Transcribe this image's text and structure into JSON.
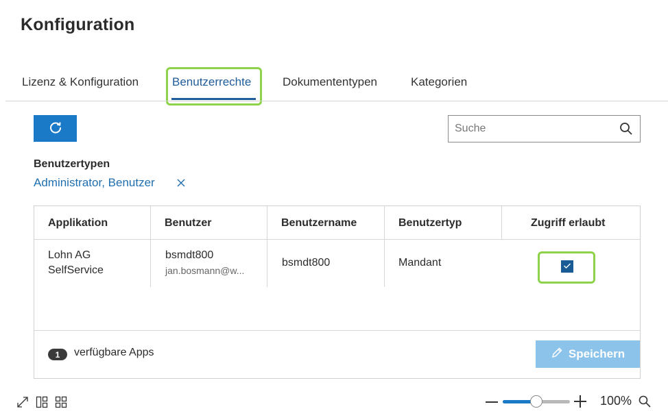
{
  "page": {
    "title": "Konfiguration"
  },
  "tabs": [
    {
      "label": "Lizenz & Konfiguration",
      "active": false
    },
    {
      "label": "Benutzerrechte",
      "active": true
    },
    {
      "label": "Dokumententypen",
      "active": false
    },
    {
      "label": "Kategorien",
      "active": false
    }
  ],
  "toolbar": {
    "refresh_icon": "refresh-icon"
  },
  "search": {
    "placeholder": "Suche",
    "value": ""
  },
  "filter": {
    "label": "Benutzertypen",
    "value": "Administrator, Benutzer"
  },
  "table": {
    "columns": [
      "Applikation",
      "Benutzer",
      "Benutzername",
      "Benutzertyp",
      "Zugriff erlaubt"
    ],
    "rows": [
      {
        "applikation_line1": "Lohn AG",
        "applikation_line2": "SelfService",
        "benutzer": "bsmdt800",
        "benutzer_email": "jan.bosmann@w...",
        "benutzername": "bsmdt800",
        "benutzertyp": "Mandant",
        "zugriff": true
      }
    ]
  },
  "footer": {
    "count": "1",
    "count_label": "verfügbare Apps",
    "save_label": "Speichern"
  },
  "zoom": {
    "level": 0.5,
    "label": "100%"
  },
  "colors": {
    "accent": "#1a7ac8",
    "tab_active": "#1f5c9b",
    "highlight": "#8ed24a",
    "save_disabled": "#8cc3ea"
  }
}
